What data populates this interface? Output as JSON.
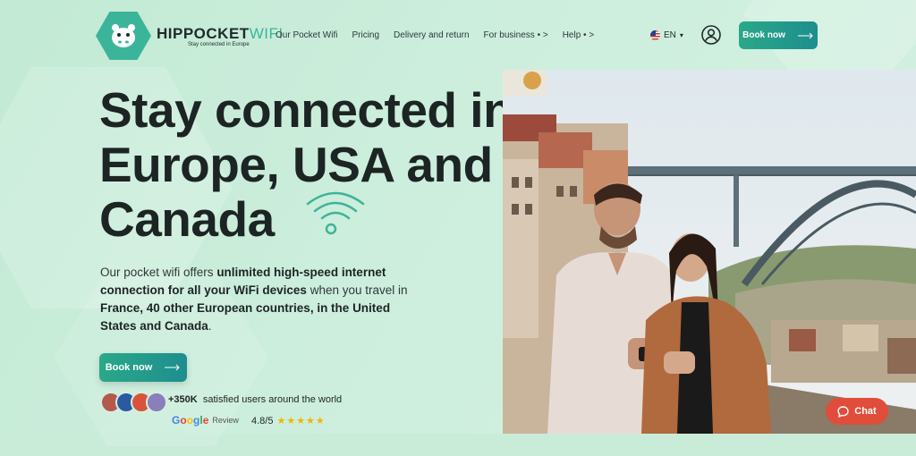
{
  "brand": {
    "name_part1": "HIPPOCKET",
    "name_part2": "WIFI",
    "tagline": "Stay connected in Europe"
  },
  "nav": {
    "items": [
      {
        "label": "Our Pocket Wifi"
      },
      {
        "label": "Pricing"
      },
      {
        "label": "Delivery and return"
      },
      {
        "label": "For business",
        "suffix": "•  >"
      },
      {
        "label": "Help",
        "suffix": "•  >"
      }
    ]
  },
  "language": {
    "code": "EN",
    "caret": "▾"
  },
  "header": {
    "book_label": "Book now"
  },
  "hero": {
    "headline": "Stay connected in Europe, USA and Canada",
    "desc_parts": [
      {
        "text": "Our pocket wifi offers ",
        "bold": false
      },
      {
        "text": "unlimited high-speed internet connection for all your WiFi devices",
        "bold": true
      },
      {
        "text": " when you travel in ",
        "bold": false
      },
      {
        "text": "France, 40 other European countries, in the United States and Canada",
        "bold": true
      },
      {
        "text": ".",
        "bold": false
      }
    ],
    "book_label": "Book now"
  },
  "social_proof": {
    "users_count": "+350K",
    "users_text": "satisfied users around the world",
    "google_label": "Google",
    "review_label": "Review",
    "rating": "4.8/5",
    "stars": "★★★★★"
  },
  "chat": {
    "label": "Chat"
  },
  "colors": {
    "accent": "#2aa889",
    "accent_dark": "#1d8e8e",
    "chat": "#e04d3b",
    "star": "#f4b400"
  }
}
